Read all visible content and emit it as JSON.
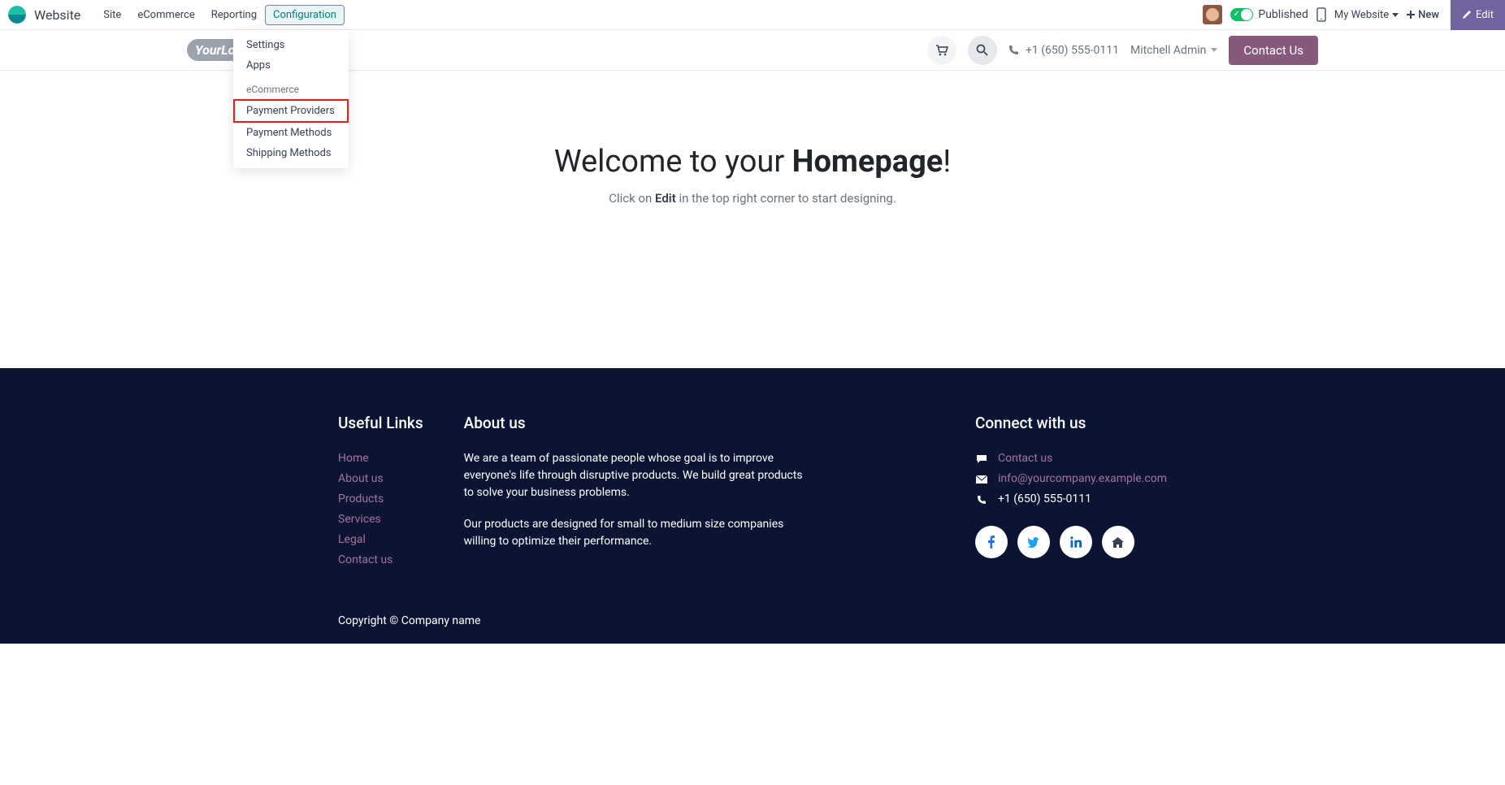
{
  "topbar": {
    "app_title": "Website",
    "menu": [
      "Site",
      "eCommerce",
      "Reporting",
      "Configuration"
    ],
    "published_label": "Published",
    "my_website_label": "My Website",
    "new_label": "New",
    "edit_label": "Edit"
  },
  "config_dropdown": {
    "items": [
      "Settings",
      "Apps"
    ],
    "section": "eCommerce",
    "sub_items": [
      "Payment Providers",
      "Payment Methods",
      "Shipping Methods"
    ],
    "highlighted_index": 0
  },
  "site_header": {
    "logo_text": "YourLogo",
    "nav": [
      "Contact us"
    ],
    "phone": "+1 (650) 555-0111",
    "user": "Mitchell Admin",
    "contact_btn": "Contact Us"
  },
  "hero": {
    "welcome_pre": "Welcome to your ",
    "welcome_strong": "Homepage",
    "welcome_post": "!",
    "subtitle_pre": "Click on ",
    "subtitle_strong": "Edit",
    "subtitle_post": " in the top right corner to start designing."
  },
  "footer": {
    "links_title": "Useful Links",
    "links": [
      "Home",
      "About us",
      "Products",
      "Services",
      "Legal",
      "Contact us"
    ],
    "about_title": "About us",
    "about_p1": "We are a team of passionate people whose goal is to improve everyone's life through disruptive products. We build great products to solve your business problems.",
    "about_p2": "Our products are designed for small to medium size companies willing to optimize their performance.",
    "connect_title": "Connect with us",
    "contact_link": "Contact us",
    "email": "info@yourcompany.example.com",
    "phone": "+1 (650) 555-0111",
    "copyright": "Copyright © Company name"
  }
}
